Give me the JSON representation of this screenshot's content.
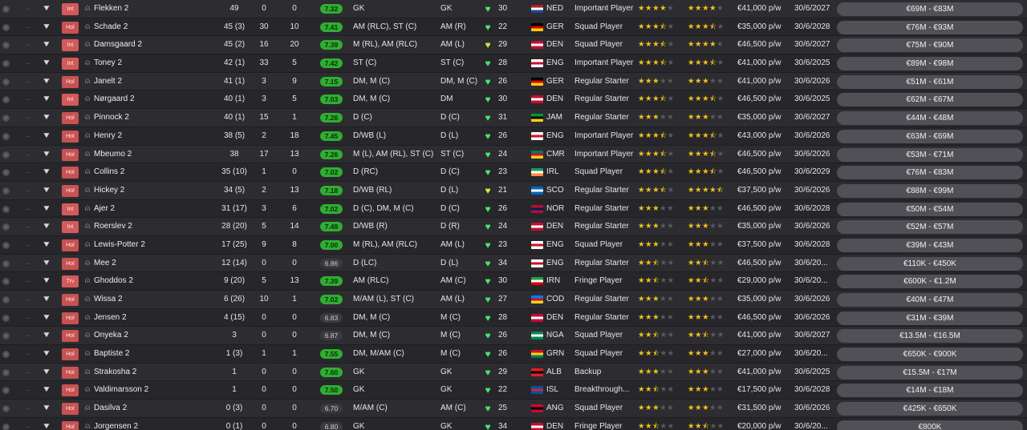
{
  "table": {
    "rows": [
      {
        "status": "Int",
        "name": "Flekken 2",
        "apps": "49",
        "goals": "0",
        "assists": "0",
        "rating": "7.32",
        "pos1": "GK",
        "pos2": "GK",
        "heart": "green",
        "fitness": "30",
        "flag": "NED",
        "nat": "NED",
        "role": "Important Player",
        "ability": 4,
        "potential": 4,
        "wage": "€41,000 p/w",
        "expiry": "30/6/2027",
        "value": "€69M - €83M"
      },
      {
        "status": "Hol",
        "name": "Schade 2",
        "apps": "45 (3)",
        "goals": "30",
        "assists": "10",
        "rating": "7.41",
        "pos1": "AM (RLC), ST (C)",
        "pos2": "AM (R)",
        "heart": "green",
        "fitness": "22",
        "flag": "GER",
        "nat": "GER",
        "role": "Squad Player",
        "ability": 3.5,
        "potential": 3.5,
        "wage": "€35,000 p/w",
        "expiry": "30/6/2028",
        "value": "€76M - €93M"
      },
      {
        "status": "Int",
        "name": "Damsgaard 2",
        "apps": "45 (2)",
        "goals": "16",
        "assists": "20",
        "rating": "7.39",
        "pos1": "M (RL), AM (RLC)",
        "pos2": "AM (L)",
        "heart": "yellow",
        "fitness": "29",
        "flag": "DEN",
        "nat": "DEN",
        "role": "Squad Player",
        "ability": 3.5,
        "potential": 4,
        "wage": "€46,500 p/w",
        "expiry": "30/6/2027",
        "value": "€75M - €90M"
      },
      {
        "status": "Int",
        "name": "Toney 2",
        "apps": "42 (1)",
        "goals": "33",
        "assists": "5",
        "rating": "7.42",
        "pos1": "ST (C)",
        "pos2": "ST (C)",
        "heart": "green",
        "fitness": "28",
        "flag": "ENG",
        "nat": "ENG",
        "role": "Important Player",
        "ability": 3.5,
        "potential": 3.5,
        "wage": "€41,000 p/w",
        "expiry": "30/6/2025",
        "value": "€89M - €98M"
      },
      {
        "status": "Hol",
        "name": "Janelt 2",
        "apps": "41 (1)",
        "goals": "3",
        "assists": "9",
        "rating": "7.15",
        "pos1": "DM, M (C)",
        "pos2": "DM, M (C)",
        "heart": "green",
        "fitness": "26",
        "flag": "GER",
        "nat": "GER",
        "role": "Regular Starter",
        "ability": 3,
        "potential": 3,
        "wage": "€41,000 p/w",
        "expiry": "30/6/2026",
        "value": "€51M - €61M"
      },
      {
        "status": "Int",
        "name": "Nørgaard 2",
        "apps": "40 (1)",
        "goals": "3",
        "assists": "5",
        "rating": "7.03",
        "pos1": "DM, M (C)",
        "pos2": "DM",
        "heart": "green",
        "fitness": "30",
        "flag": "DEN",
        "nat": "DEN",
        "role": "Regular Starter",
        "ability": 3.5,
        "potential": 3.5,
        "wage": "€46,500 p/w",
        "expiry": "30/6/2025",
        "value": "€62M - €67M"
      },
      {
        "status": "Hol",
        "name": "Pinnock 2",
        "apps": "40 (1)",
        "goals": "15",
        "assists": "1",
        "rating": "7.26",
        "pos1": "D (C)",
        "pos2": "D (C)",
        "heart": "green",
        "fitness": "31",
        "flag": "JAM",
        "nat": "JAM",
        "role": "Regular Starter",
        "ability": 3,
        "potential": 3,
        "wage": "€35,000 p/w",
        "expiry": "30/6/2027",
        "value": "€44M - €48M"
      },
      {
        "status": "Hol",
        "name": "Henry 2",
        "apps": "38 (5)",
        "goals": "2",
        "assists": "18",
        "rating": "7.45",
        "pos1": "D/WB (L)",
        "pos2": "D (L)",
        "heart": "green",
        "fitness": "26",
        "flag": "ENG",
        "nat": "ENG",
        "role": "Important Player",
        "ability": 3.5,
        "potential": 3.5,
        "wage": "€43,000 p/w",
        "expiry": "30/6/2026",
        "value": "€63M - €69M"
      },
      {
        "status": "Hol",
        "name": "Mbeumo 2",
        "apps": "38",
        "goals": "17",
        "assists": "13",
        "rating": "7.26",
        "pos1": "M (L), AM (RL), ST (C)",
        "pos2": "ST (C)",
        "heart": "green",
        "fitness": "24",
        "flag": "CMR",
        "nat": "CMR",
        "role": "Important Player",
        "ability": 3.5,
        "potential": 3.5,
        "wage": "€46,500 p/w",
        "expiry": "30/6/2026",
        "value": "€53M - €71M"
      },
      {
        "status": "Hol",
        "name": "Collins 2",
        "apps": "35 (10)",
        "goals": "1",
        "assists": "0",
        "rating": "7.02",
        "pos1": "D (RC)",
        "pos2": "D (C)",
        "heart": "green",
        "fitness": "23",
        "flag": "IRL",
        "nat": "IRL",
        "role": "Squad Player",
        "ability": 3.5,
        "potential": 3.5,
        "wage": "€46,500 p/w",
        "expiry": "30/6/2029",
        "value": "€76M - €83M"
      },
      {
        "status": "Hol",
        "name": "Hickey 2",
        "apps": "34 (5)",
        "goals": "2",
        "assists": "13",
        "rating": "7.18",
        "pos1": "D/WB (RL)",
        "pos2": "D (L)",
        "heart": "yellow",
        "fitness": "21",
        "flag": "SCO",
        "nat": "SCO",
        "role": "Regular Starter",
        "ability": 3.5,
        "potential": 4.5,
        "wage": "€37,500 p/w",
        "expiry": "30/6/2026",
        "value": "€88M - €99M"
      },
      {
        "status": "Int",
        "name": "Ajer 2",
        "apps": "31 (17)",
        "goals": "3",
        "assists": "6",
        "rating": "7.02",
        "pos1": "D (C), DM, M (C)",
        "pos2": "D (C)",
        "heart": "green",
        "fitness": "26",
        "flag": "NOR",
        "nat": "NOR",
        "role": "Regular Starter",
        "ability": 3,
        "potential": 3,
        "wage": "€46,500 p/w",
        "expiry": "30/6/2028",
        "value": "€50M - €54M"
      },
      {
        "status": "Int",
        "name": "Roerslev 2",
        "apps": "28 (20)",
        "goals": "5",
        "assists": "14",
        "rating": "7.48",
        "pos1": "D/WB (R)",
        "pos2": "D (R)",
        "heart": "green",
        "fitness": "24",
        "flag": "DEN",
        "nat": "DEN",
        "role": "Regular Starter",
        "ability": 3,
        "potential": 3,
        "wage": "€35,000 p/w",
        "expiry": "30/6/2026",
        "value": "€52M - €57M"
      },
      {
        "status": "Hol",
        "name": "Lewis-Potter 2",
        "apps": "17 (25)",
        "goals": "9",
        "assists": "8",
        "rating": "7.00",
        "pos1": "M (RL), AM (RLC)",
        "pos2": "AM (L)",
        "heart": "green",
        "fitness": "23",
        "flag": "ENG",
        "nat": "ENG",
        "role": "Squad Player",
        "ability": 3,
        "potential": 3,
        "wage": "€37,500 p/w",
        "expiry": "30/6/2028",
        "value": "€39M - €43M"
      },
      {
        "status": "Hol",
        "name": "Mee 2",
        "apps": "12 (14)",
        "goals": "0",
        "assists": "0",
        "rating": "6.86",
        "pos1": "D (LC)",
        "pos2": "D (L)",
        "heart": "green",
        "fitness": "34",
        "flag": "ENG",
        "nat": "ENG",
        "role": "Regular Starter",
        "ability": 2.5,
        "potential": 2.5,
        "wage": "€46,500 p/w",
        "expiry": "30/6/20...",
        "value": "€110K - €450K"
      },
      {
        "status": "Trv",
        "name": "Ghoddos 2",
        "apps": "9 (20)",
        "goals": "5",
        "assists": "13",
        "rating": "7.39",
        "pos1": "AM (RLC)",
        "pos2": "AM (C)",
        "heart": "green",
        "fitness": "30",
        "flag": "IRN",
        "nat": "IRN",
        "role": "Fringe Player",
        "ability": 2.5,
        "potential": 2.5,
        "wage": "€29,000 p/w",
        "expiry": "30/6/20...",
        "value": "€600K - €1.2M"
      },
      {
        "status": "Hol",
        "name": "Wissa 2",
        "apps": "6 (26)",
        "goals": "10",
        "assists": "1",
        "rating": "7.02",
        "pos1": "M/AM (L), ST (C)",
        "pos2": "AM (L)",
        "heart": "green",
        "fitness": "27",
        "flag": "COD",
        "nat": "COD",
        "role": "Regular Starter",
        "ability": 3,
        "potential": 3,
        "wage": "€35,000 p/w",
        "expiry": "30/6/2026",
        "value": "€40M - €47M"
      },
      {
        "status": "Hol",
        "name": "Jensen 2",
        "apps": "4 (15)",
        "goals": "0",
        "assists": "0",
        "rating": "6.83",
        "pos1": "DM, M (C)",
        "pos2": "M (C)",
        "heart": "green",
        "fitness": "28",
        "flag": "DEN",
        "nat": "DEN",
        "role": "Regular Starter",
        "ability": 3,
        "potential": 3,
        "wage": "€46,500 p/w",
        "expiry": "30/6/2026",
        "value": "€31M - €39M"
      },
      {
        "status": "Hol",
        "name": "Onyeka 2",
        "apps": "3",
        "goals": "0",
        "assists": "0",
        "rating": "6.87",
        "pos1": "DM, M (C)",
        "pos2": "M (C)",
        "heart": "green",
        "fitness": "26",
        "flag": "NGA",
        "nat": "NGA",
        "role": "Squad Player",
        "ability": 2.5,
        "potential": 2.5,
        "wage": "€41,000 p/w",
        "expiry": "30/6/2027",
        "value": "€13.5M - €16.5M"
      },
      {
        "status": "Hol",
        "name": "Baptiste 2",
        "apps": "1 (3)",
        "goals": "1",
        "assists": "1",
        "rating": "7.55",
        "pos1": "DM, M/AM (C)",
        "pos2": "M (C)",
        "heart": "green",
        "fitness": "26",
        "flag": "GRN",
        "nat": "GRN",
        "role": "Squad Player",
        "ability": 2.5,
        "potential": 3,
        "wage": "€27,000 p/w",
        "expiry": "30/6/20...",
        "value": "€650K - €900K"
      },
      {
        "status": "Hol",
        "name": "Strakosha 2",
        "apps": "1",
        "goals": "0",
        "assists": "0",
        "rating": "7.60",
        "pos1": "GK",
        "pos2": "GK",
        "heart": "green",
        "fitness": "29",
        "flag": "ALB",
        "nat": "ALB",
        "role": "Backup",
        "ability": 3,
        "potential": 3,
        "wage": "€41,000 p/w",
        "expiry": "30/6/2025",
        "value": "€15.5M - €17M"
      },
      {
        "status": "Hol",
        "name": "Valdimarsson 2",
        "apps": "1",
        "goals": "0",
        "assists": "0",
        "rating": "7.50",
        "pos1": "GK",
        "pos2": "GK",
        "heart": "green",
        "fitness": "22",
        "flag": "ISL",
        "nat": "ISL",
        "role": "Breakthrough...",
        "ability": 2.5,
        "potential": 3,
        "wage": "€17,500 p/w",
        "expiry": "30/6/2028",
        "value": "€14M - €18M"
      },
      {
        "status": "Hol",
        "name": "Dasilva 2",
        "apps": "0 (3)",
        "goals": "0",
        "assists": "0",
        "rating": "6.70",
        "pos1": "M/AM (C)",
        "pos2": "AM (C)",
        "heart": "green",
        "fitness": "25",
        "flag": "ANG",
        "nat": "ANG",
        "role": "Squad Player",
        "ability": 3,
        "potential": 3,
        "wage": "€31,500 p/w",
        "expiry": "30/6/2026",
        "value": "€425K - €650K"
      },
      {
        "status": "Hol",
        "name": "Jorgensen 2",
        "apps": "0 (1)",
        "goals": "0",
        "assists": "0",
        "rating": "6.80",
        "pos1": "GK",
        "pos2": "GK",
        "heart": "green",
        "fitness": "34",
        "flag": "DEN",
        "nat": "DEN",
        "role": "Fringe Player",
        "ability": 2.5,
        "potential": 2.5,
        "wage": "€20,000 p/w",
        "expiry": "30/6/20...",
        "value": "€800K"
      }
    ]
  },
  "flag_colors": {
    "NED": [
      "#ae1c28",
      "#ffffff",
      "#21468b"
    ],
    "GER": [
      "#000000",
      "#dd0000",
      "#ffce00"
    ],
    "DEN": [
      "#c60c30",
      "#ffffff",
      "#c60c30"
    ],
    "ENG": [
      "#ffffff",
      "#ce1124",
      "#ffffff"
    ],
    "JAM": [
      "#009b3a",
      "#000000",
      "#fed100"
    ],
    "CMR": [
      "#007a5e",
      "#ce1126",
      "#fcd116"
    ],
    "IRL": [
      "#169b62",
      "#ffffff",
      "#ff883e"
    ],
    "SCO": [
      "#0065bd",
      "#ffffff",
      "#0065bd"
    ],
    "NOR": [
      "#ba0c2f",
      "#00205b",
      "#ba0c2f"
    ],
    "IRN": [
      "#239f40",
      "#ffffff",
      "#da0000"
    ],
    "COD": [
      "#007fff",
      "#ce1021",
      "#f7d618"
    ],
    "NGA": [
      "#008751",
      "#ffffff",
      "#008751"
    ],
    "GRN": [
      "#ce1126",
      "#fcd116",
      "#007a5e"
    ],
    "ALB": [
      "#e41e20",
      "#000000",
      "#e41e20"
    ],
    "ISL": [
      "#02529c",
      "#dc1e35",
      "#02529c"
    ],
    "ANG": [
      "#cc092f",
      "#000000",
      "#cc092f"
    ]
  },
  "colors": {
    "rating_green": "#2fae31",
    "rating_grey": "#3a3a3f",
    "heart_green": "#47e86a",
    "heart_yellow": "#d7e53a",
    "star_gold": "#f0c419",
    "status_red": "#d35a5a"
  },
  "icons": {
    "row_select": "radio-circle-icon",
    "expand": "chevron-down-icon",
    "person": "person-icon",
    "condition": "heart-icon",
    "star": "star-icon"
  }
}
